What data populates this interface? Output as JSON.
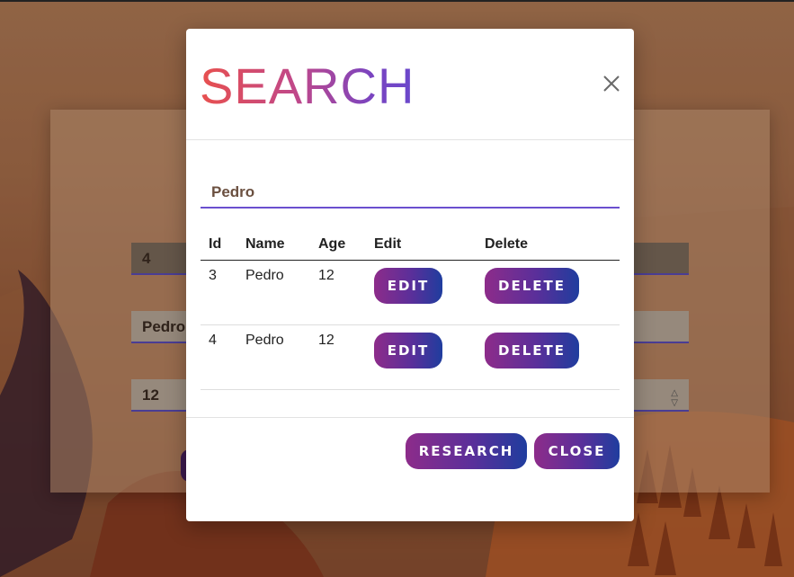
{
  "background_form": {
    "id_value": "4",
    "name_value": "Pedro",
    "age_value": "12"
  },
  "modal": {
    "title": "SEARCH",
    "close_icon": "close-icon",
    "search_value": "Pedro",
    "table": {
      "headers": [
        "Id",
        "Name",
        "Age",
        "Edit",
        "Delete"
      ],
      "rows": [
        {
          "id": "3",
          "name": "Pedro",
          "age": "12",
          "edit_label": "EDIT",
          "delete_label": "DELETE"
        },
        {
          "id": "4",
          "name": "Pedro",
          "age": "12",
          "edit_label": "EDIT",
          "delete_label": "DELETE"
        }
      ]
    },
    "footer": {
      "research_label": "RESEARCH",
      "close_label": "CLOSE"
    }
  },
  "colors": {
    "title_gradient_start": "#e8504e",
    "title_gradient_end": "#6a48cc",
    "button_gradient_start": "#8d2c8a",
    "button_gradient_end": "#1f3d9e",
    "input_underline": "#6a4fcf"
  }
}
